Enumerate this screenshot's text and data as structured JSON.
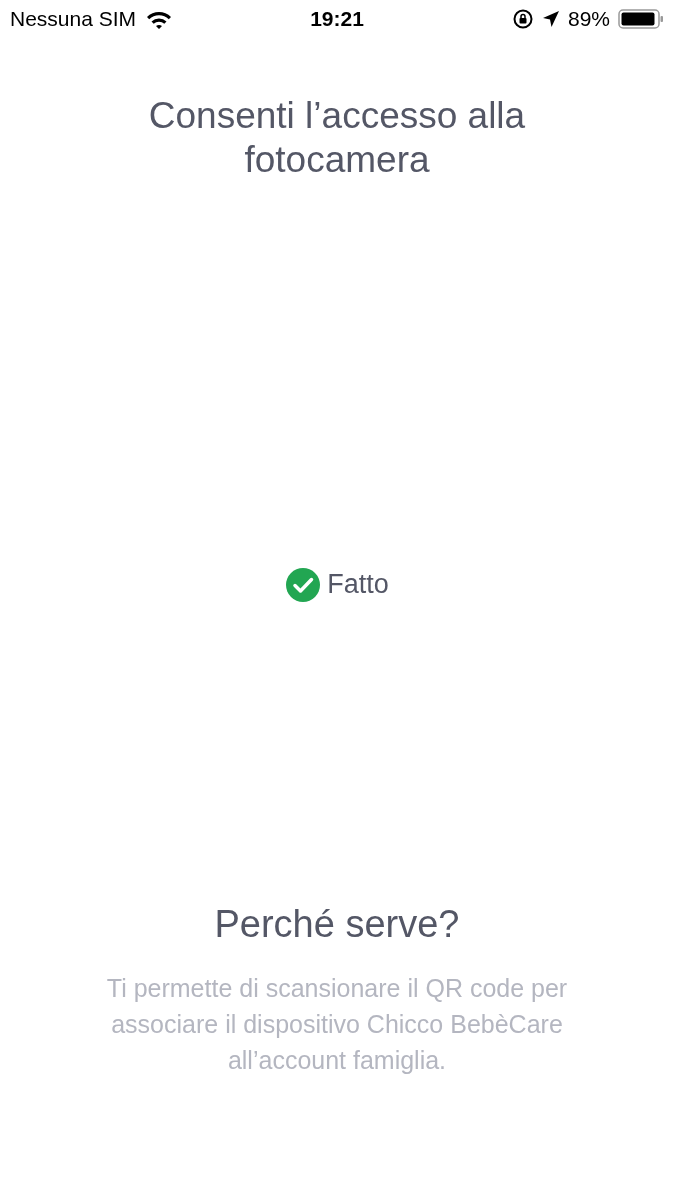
{
  "status_bar": {
    "carrier": "Nessuna SIM",
    "time": "19:21",
    "battery": "89%"
  },
  "title": "Consenti l’accesso alla fotocamera",
  "status": {
    "label": "Fatto",
    "done": true
  },
  "info": {
    "heading": "Perché serve?",
    "text": "Ti permette di scansionare il QR code per associare il dispositivo Chicco BebèCare all’account famiglia."
  }
}
